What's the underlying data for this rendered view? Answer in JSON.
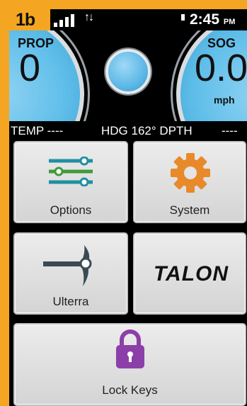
{
  "status_bar": {
    "badge": "1b",
    "time": "2:45",
    "ampm": "PM",
    "data_arrows": "↑↓"
  },
  "gauges": {
    "prop_label": "PROP",
    "prop_value": "0",
    "sog_label": "SOG",
    "sog_value": "0.0",
    "sog_unit": "mph"
  },
  "info_bar": {
    "temp": "TEMP ----",
    "heading": "HDG 162° DPTH",
    "depth": "----"
  },
  "tiles": {
    "options": "Options",
    "system": "System",
    "ulterra": "Ulterra",
    "talon": "TALON",
    "lock_keys": "Lock Keys"
  },
  "colors": {
    "accent": "#f4a623",
    "gauge_blue": "#61bfea",
    "options_teal": "#1f8fa3",
    "options_green": "#3f9a3a",
    "system_orange": "#e8892a",
    "lock_purple": "#8c3fa8"
  },
  "icons": {
    "options": "sliders-icon",
    "system": "gear-icon",
    "ulterra": "trolling-motor-icon",
    "lock_keys": "padlock-icon"
  }
}
